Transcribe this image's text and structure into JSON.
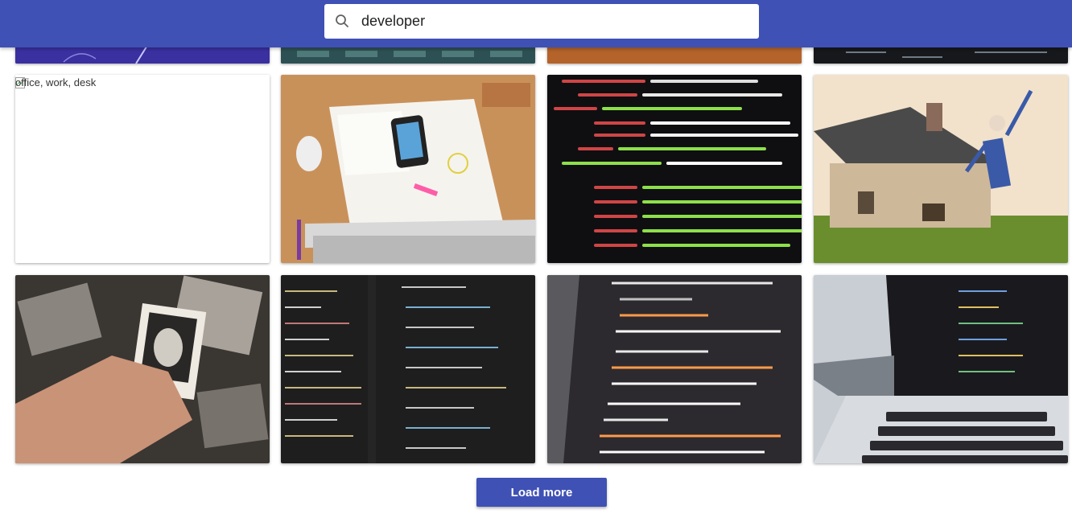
{
  "search": {
    "value": "developer",
    "icon": "search-icon"
  },
  "colors": {
    "header": "#3f51b5",
    "button": "#3f51b5",
    "background": "#ffffff"
  },
  "images": {
    "broken_alt": "office, work, desk"
  },
  "load_more": {
    "label": "Load more"
  }
}
